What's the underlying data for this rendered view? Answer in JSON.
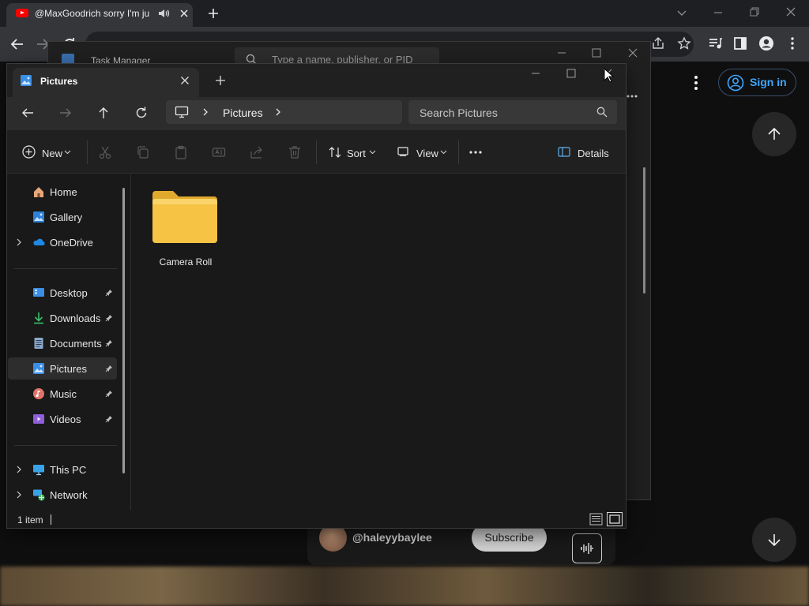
{
  "browser": {
    "tab_title": "@MaxGoodrich sorry I'm ju",
    "tab_favicon": "youtube-icon",
    "youtube": {
      "sign_in_label": "Sign in",
      "channel_handle": "@haleyybaylee",
      "subscribe_label": "Subscribe",
      "accent_color": "#3ea6ff"
    }
  },
  "task_manager": {
    "title": "Task Manager",
    "search_placeholder": "Type a name, publisher, or PID"
  },
  "explorer": {
    "tab_label": "Pictures",
    "address": {
      "root_icon": "computer-icon",
      "segment": "Pictures"
    },
    "search_placeholder": "Search Pictures",
    "command_bar": {
      "new_label": "New",
      "sort_label": "Sort",
      "view_label": "View",
      "details_label": "Details"
    },
    "nav_items": [
      {
        "label": "Home",
        "icon": "home-icon"
      },
      {
        "label": "Gallery",
        "icon": "gallery-icon"
      },
      {
        "label": "OneDrive",
        "icon": "onedrive-icon"
      },
      {
        "label": "Desktop",
        "icon": "desktop-icon",
        "pinned": true
      },
      {
        "label": "Downloads",
        "icon": "downloads-icon",
        "pinned": true
      },
      {
        "label": "Documents",
        "icon": "documents-icon",
        "pinned": true
      },
      {
        "label": "Pictures",
        "icon": "pictures-icon",
        "pinned": true,
        "selected": true
      },
      {
        "label": "Music",
        "icon": "music-icon",
        "pinned": true
      },
      {
        "label": "Videos",
        "icon": "videos-icon",
        "pinned": true
      },
      {
        "label": "This PC",
        "icon": "this-pc-icon"
      },
      {
        "label": "Network",
        "icon": "network-icon"
      }
    ],
    "items": [
      {
        "name": "Camera Roll",
        "type": "folder"
      }
    ],
    "status": {
      "item_count": "1 item"
    },
    "folder_color": "#f6c344",
    "selection_color": "#2d2d2d"
  }
}
